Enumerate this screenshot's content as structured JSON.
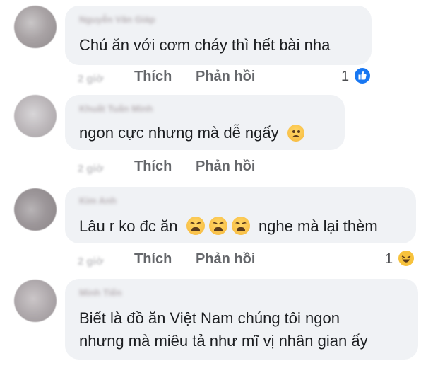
{
  "comments": [
    {
      "author": "Nguyễn Văn Giáp",
      "text": "Chú ăn với cơm cháy thì hết bài nha",
      "time": "2 giờ",
      "like_label": "Thích",
      "reply_label": "Phản hồi",
      "reaction_count": "1",
      "reaction_icon": "like-reaction-icon"
    },
    {
      "author": "Khuất Tuấn Minh",
      "text": "ngon cực nhưng mà dễ ngấy",
      "emoji": "sad-face-emoji",
      "time": "2 giờ",
      "like_label": "Thích",
      "reply_label": "Phản hồi"
    },
    {
      "author": "Kim Anh",
      "text_before": "Lâu r ko đc ăn",
      "emojis": [
        "weary-face-emoji",
        "weary-face-emoji",
        "weary-face-emoji"
      ],
      "text_after": "nghe mà lại thèm",
      "time": "2 giờ",
      "like_label": "Thích",
      "reply_label": "Phản hồi",
      "reaction_count": "1",
      "reaction_icon": "haha-reaction-icon"
    },
    {
      "author": "Minh Tiến",
      "text_line1": "Biết là đồ ăn Việt Nam chúng tôi ngon",
      "text_line2": "nhưng mà miêu tả như mĩ vị nhân gian ấy"
    }
  ],
  "colors": {
    "bubble": "#f0f2f5",
    "text": "#1c1e21",
    "action": "#65676b",
    "like_blue": "#1877f2",
    "haha_yellow": "#f7c23c"
  }
}
